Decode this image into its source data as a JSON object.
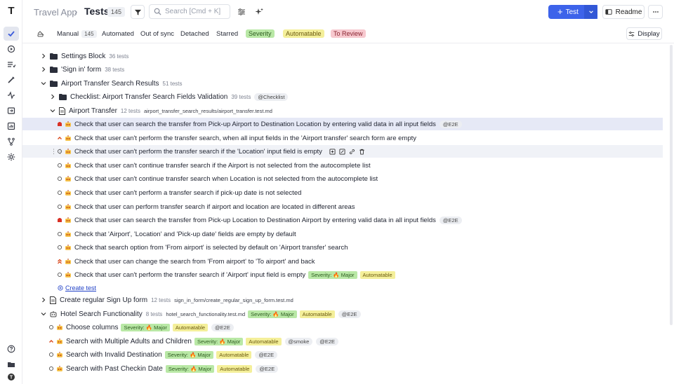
{
  "header": {
    "app_name": "Travel App",
    "separator": "›",
    "title": "Tests",
    "count": "145",
    "search_placeholder": "Search [Cmd + K]",
    "new_button": "Test",
    "readme_button": "Readme"
  },
  "filters": {
    "tabs": [
      {
        "label": "Manual",
        "count": "145"
      },
      {
        "label": "Automated"
      },
      {
        "label": "Out of sync"
      },
      {
        "label": "Detached"
      },
      {
        "label": "Starred"
      }
    ],
    "chips": {
      "severity": "Severity",
      "automatable": "Automatable",
      "review": "To Review"
    },
    "display_button": "Display"
  },
  "tree": {
    "suites_top": [
      {
        "label": "Settings Block",
        "count": "36 tests"
      },
      {
        "label": "'Sign in' form",
        "count": "38 tests"
      }
    ],
    "airport_suite": {
      "label": "Airport Transfer Search Results",
      "count": "51 tests"
    },
    "checklist_suite": {
      "label": "Checklist: Airport Transfer Search Fields Validation",
      "count": "39 tests",
      "tag": "@Checklist"
    },
    "airport_file": {
      "label": "Airport Transfer",
      "count": "12 tests",
      "path": "airport_transfer_search_results/airport_transfer.test.md"
    },
    "tests": [
      {
        "label": "Check that user can search the transfer from Pick-up Airport to Destination Location by entering valid data in all input fields",
        "tag": "@E2E"
      },
      {
        "label": "Check that user can't perform the transfer search, when all input fields in the 'Airport transfer' search form are empty"
      },
      {
        "label": "Check that user can't perform the transfer search if the 'Location' input field is empty"
      },
      {
        "label": "Check that user can't continue transfer search if the Airport is not selected from the autocomplete list"
      },
      {
        "label": "Check that user can't continue transfer search when Location is not selected from the autocomplete list"
      },
      {
        "label": "Check that user can't perform a transfer search if pick-up date is not selected"
      },
      {
        "label": "Check that user can perform transfer search if airport and location are located in different areas"
      },
      {
        "label": "Check that user can search the transfer from Pick-up Location to Destination Airport by entering valid data in all input fields",
        "tag": "@E2E"
      },
      {
        "label": "Check that 'Airport', 'Location' and 'Pick-up date' fields are empty by default"
      },
      {
        "label": "Check that search option from 'From airport' is selected by default on 'Airport transfer' search"
      },
      {
        "label": "Check that user can change the search from 'From airport' to 'To airport' and back"
      },
      {
        "label": "Check that user can't perform the transfer search if 'Airport' input field is empty",
        "severity": "Severity: 🔥 Major",
        "automatable": "Automatable"
      }
    ],
    "create_test": "Create test",
    "signup_file": {
      "label": "Create regular Sign Up form",
      "count": "12 tests",
      "path": "sign_in_form/create_regular_sign_up_form.test.md"
    },
    "hotel_file": {
      "label": "Hotel Search Functionality",
      "count": "8 tests",
      "path": "hotel_search_functionality.test.md",
      "severity": "Severity: 🔥 Major",
      "automatable": "Automatable",
      "tag": "@E2E"
    },
    "hotel_tests": [
      {
        "label": "Choose columns",
        "severity": "Severity: 🔥 Major",
        "automatable": "Automatable",
        "tag": "@E2E"
      },
      {
        "label": "Search with Multiple Adults and Children",
        "severity": "Severity: 🔥 Major",
        "automatable": "Automatable",
        "tag2": "@smoke",
        "tag": "@E2E"
      },
      {
        "label": "Search with Invalid Destination",
        "severity": "Severity: 🔥 Major",
        "automatable": "Automatable",
        "tag": "@E2E"
      },
      {
        "label": "Search with Past Checkin Date",
        "severity": "Severity: 🔥 Major",
        "automatable": "Automatable",
        "tag": "@E2E"
      }
    ]
  },
  "colors": {
    "accent": "#3d63ea",
    "critical": "#d93025",
    "highlight": "#e6e9f6"
  }
}
